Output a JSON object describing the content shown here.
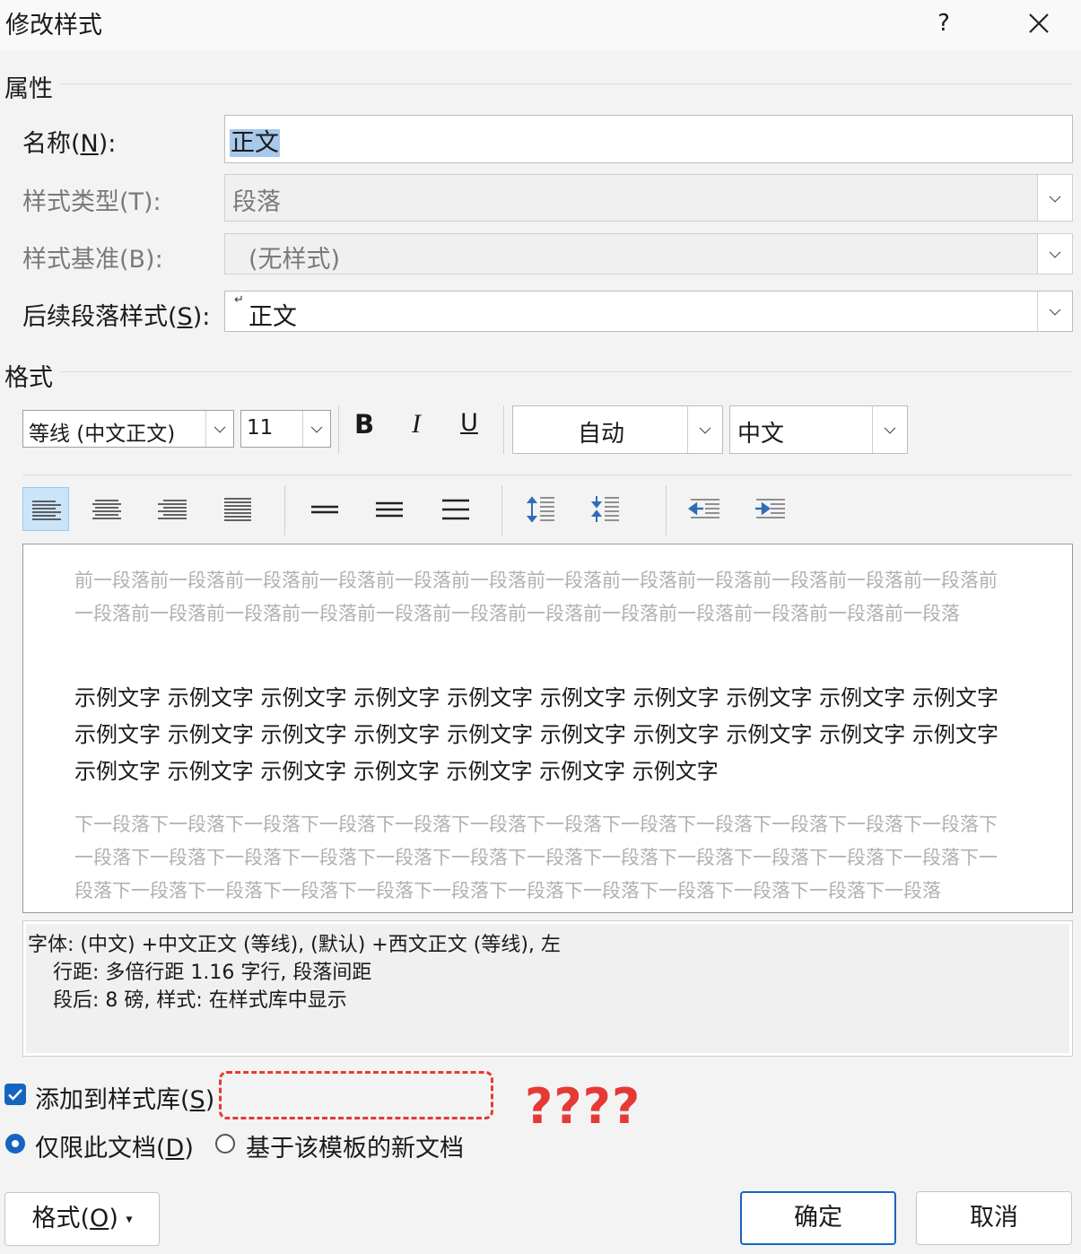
{
  "dialog": {
    "title": "修改样式",
    "help_label": "?"
  },
  "properties": {
    "section_label": "属性",
    "name": {
      "label_pre": "名称(",
      "label_key": "N",
      "label_post": "):",
      "value": "正文"
    },
    "style_type": {
      "label": "样式类型(T):",
      "value": "段落"
    },
    "based_on": {
      "label": "样式基准(B):",
      "value": "(无样式)"
    },
    "next_style": {
      "label_pre": "后续段落样式(",
      "label_key": "S",
      "label_post": "):",
      "marker": "↵",
      "value": "正文"
    }
  },
  "format": {
    "section_label": "格式",
    "font": "等线 (中文正文)",
    "size": "11",
    "bold_label": "B",
    "italic_label": "I",
    "underline_label": "U",
    "color": "自动",
    "language": "中文"
  },
  "paragraph_buttons": [
    {
      "name": "align-left-icon",
      "selected": true
    },
    {
      "name": "align-center-icon"
    },
    {
      "name": "align-right-icon"
    },
    {
      "name": "justify-icon"
    },
    {
      "name": "single-spacing-icon"
    },
    {
      "name": "one-half-spacing-icon"
    },
    {
      "name": "double-spacing-icon"
    },
    {
      "name": "increase-paragraph-spacing-icon"
    },
    {
      "name": "decrease-paragraph-spacing-icon"
    },
    {
      "name": "decrease-indent-icon"
    },
    {
      "name": "increase-indent-icon"
    }
  ],
  "preview": {
    "prev": "前一段落前一段落前一段落前一段落前一段落前一段落前一段落前一段落前一段落前一段落前一段落前一段落前一段落前一段落前一段落前一段落前一段落前一段落前一段落前一段落前一段落前一段落前一段落前一段落",
    "sample": "示例文字 示例文字 示例文字 示例文字 示例文字 示例文字 示例文字 示例文字 示例文字 示例文字 示例文字 示例文字 示例文字 示例文字 示例文字 示例文字 示例文字 示例文字 示例文字 示例文字 示例文字 示例文字 示例文字 示例文字 示例文字 示例文字 示例文字",
    "next": "下一段落下一段落下一段落下一段落下一段落下一段落下一段落下一段落下一段落下一段落下一段落下一段落下一段落下一段落下一段落下一段落下一段落下一段落下一段落下一段落下一段落下一段落下一段落下一段落下一段落下一段落下一段落下一段落下一段落下一段落下一段落下一段落下一段落下一段落下一段落下一段落"
  },
  "description": [
    "字体: (中文) +中文正文 (等线), (默认) +西文正文 (等线), 左",
    "行距: 多倍行距 1.16 字行, 段落间距",
    "段后: 8 磅, 样式: 在样式库中显示"
  ],
  "options": {
    "add_to_gallery": {
      "label_pre": "添加到样式库(",
      "label_key": "S",
      "label_post": ")",
      "checked": true
    },
    "this_doc_only": {
      "label_pre": "仅限此文档(",
      "label_key": "D",
      "label_post": ")",
      "selected": true
    },
    "new_docs_template": {
      "label": "基于该模板的新文档",
      "selected": false
    }
  },
  "annotation": {
    "text": "????",
    "color": "#e53935"
  },
  "buttons": {
    "format": {
      "label_pre": "格式(",
      "label_key": "O",
      "label_post": ")",
      "arrow": "▾"
    },
    "ok": "确定",
    "cancel": "取消"
  },
  "colors": {
    "accent": "#1565c0",
    "selection": "#a8c8ec",
    "annotation": "#e53935"
  }
}
